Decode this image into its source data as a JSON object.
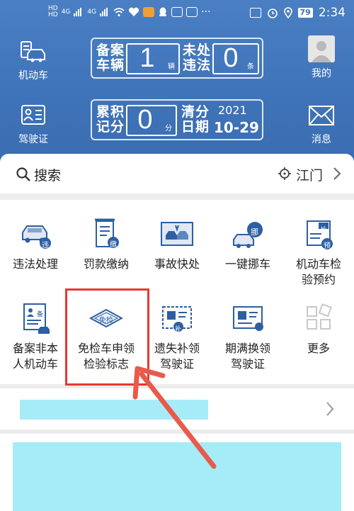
{
  "status_bar": {
    "hd1": "HD",
    "hd2": "HD",
    "net1": "4G",
    "net2": "4G",
    "battery": "79",
    "time": "2:34"
  },
  "header": {
    "vehicle_label": "机动车",
    "license_label": "驾驶证",
    "mine_label": "我的",
    "message_label": "消息",
    "registered_vehicles": {
      "label": "备案\n车辆",
      "value": "1",
      "unit": "辆"
    },
    "unhandled_violations": {
      "label": "未处\n违法",
      "value": "0",
      "unit": "条"
    },
    "points": {
      "label": "累积\n记分",
      "value": "0",
      "unit": "分"
    },
    "clear_date": {
      "label": "清分\n日期",
      "year": "2021",
      "date": "10-29"
    }
  },
  "search": {
    "label": "搜索",
    "location": "江门"
  },
  "services": [
    {
      "label": "违法处理",
      "badge": "违"
    },
    {
      "label": "罚款缴纳",
      "badge": "缴"
    },
    {
      "label": "事故快处"
    },
    {
      "label": "一键挪车",
      "badge": "挪"
    },
    {
      "label": "机动车检验预约",
      "badge": "预",
      "top_badge": "检"
    },
    {
      "label": "备案非本人机动车",
      "badge": "备"
    },
    {
      "label": "免检车申领检验标志",
      "badge": "免检"
    },
    {
      "label": "遗失补领驾驶证",
      "badge": "补"
    },
    {
      "label": "期满换领驾驶证"
    },
    {
      "label": "更多"
    }
  ],
  "colors": {
    "header_blue": "#3f73b8",
    "icon_blue": "#2d5fa3",
    "highlight_red": "#e53935",
    "redacted_cyan": "#a6ecf8"
  }
}
